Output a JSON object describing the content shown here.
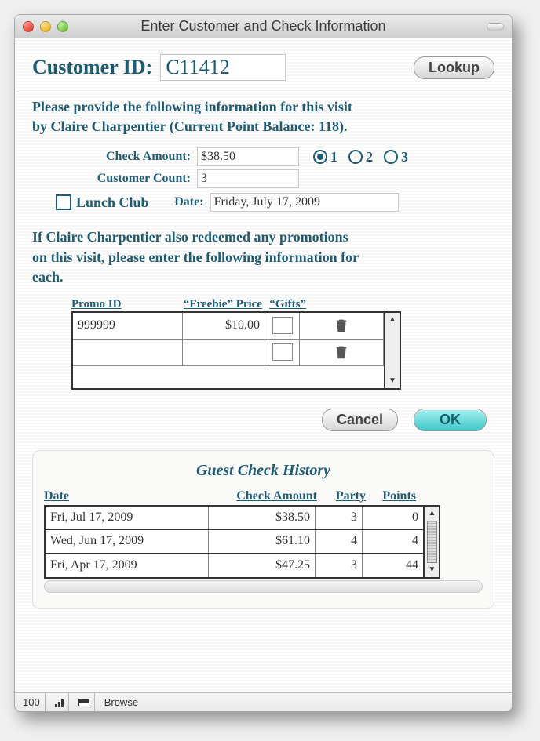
{
  "window": {
    "title": "Enter Customer and Check Information"
  },
  "customer": {
    "id_label": "Customer ID:",
    "id_value": "C11412",
    "lookup_label": "Lookup"
  },
  "visit_text_1": "Please provide the following information for this visit",
  "visit_text_2": "by Claire  Charpentier (Current Point Balance:  118).",
  "form": {
    "check_amount_label": "Check Amount:",
    "check_amount_value": "$38.50",
    "customer_count_label": "Customer Count:",
    "customer_count_value": "3",
    "date_label": "Date:",
    "date_value": "Friday, July 17, 2009",
    "lunch_club_label": "Lunch Club",
    "radio_options": [
      "1",
      "2",
      "3"
    ],
    "radio_selected": 0
  },
  "promo_text_1": "If Claire  Charpentier also redeemed any promotions",
  "promo_text_2": "on this visit, please enter the following information for",
  "promo_text_3": "each.",
  "promo_headers": {
    "id": "Promo ID",
    "price": "“Freebie” Price",
    "gifts": "“Gifts”"
  },
  "promo_rows": [
    {
      "id": "999999",
      "price": "$10.00"
    },
    {
      "id": "",
      "price": ""
    }
  ],
  "actions": {
    "cancel": "Cancel",
    "ok": "OK"
  },
  "history": {
    "title": "Guest Check History",
    "headers": {
      "date": "Date",
      "amount": "Check Amount",
      "party": "Party",
      "points": "Points"
    },
    "rows": [
      {
        "date": "Fri, Jul 17, 2009",
        "amount": "$38.50",
        "party": "3",
        "points": "0"
      },
      {
        "date": "Wed, Jun 17, 2009",
        "amount": "$61.10",
        "party": "4",
        "points": "4"
      },
      {
        "date": "Fri, Apr 17, 2009",
        "amount": "$47.25",
        "party": "3",
        "points": "44"
      }
    ]
  },
  "status_bar": {
    "zoom": "100",
    "mode": "Browse"
  }
}
